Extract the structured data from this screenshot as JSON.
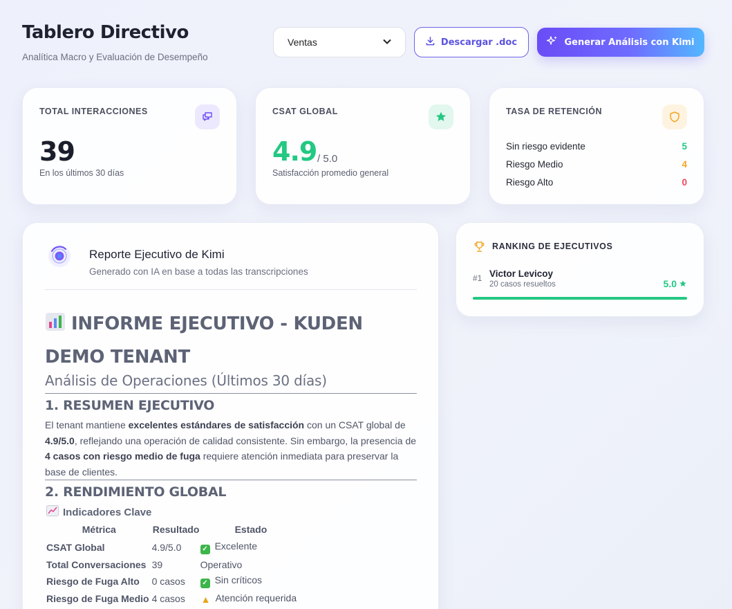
{
  "header": {
    "title": "Tablero Directivo",
    "subtitle": "Analítica Macro y Evaluación de Desempeño",
    "select_value": "Ventas",
    "download_label": "Descargar .doc",
    "ai_label": "Generar Análisis con Kimi"
  },
  "kpis": {
    "interactions": {
      "label": "TOTAL INTERACCIONES",
      "value": "39",
      "note": "En los últimos 30 días"
    },
    "csat": {
      "label": "CSAT GLOBAL",
      "value": "4.9",
      "suffix": "/ 5.0",
      "note": "Satisfacción promedio general"
    },
    "retention": {
      "label": "TASA DE RETENCIÓN",
      "rows": [
        {
          "label": "Sin riesgo evidente",
          "value": "5",
          "color": "#23c882"
        },
        {
          "label": "Riesgo Medio",
          "value": "4",
          "color": "#f5a524"
        },
        {
          "label": "Riesgo Alto",
          "value": "0",
          "color": "#ef4560"
        }
      ]
    }
  },
  "report": {
    "title": "Reporte Ejecutivo de Kimi",
    "subtitle": "Generado con IA en base a todas las transcripciones",
    "h1": "INFORME EJECUTIVO - KUDEN DEMO TENANT",
    "h2": "Análisis de Operaciones (Últimos 30 días)",
    "s1_title": "1. RESUMEN EJECUTIVO",
    "s1_p1": "El tenant mantiene ",
    "s1_b1": "excelentes estándares de satisfacción",
    "s1_p2": " con un CSAT global de ",
    "s1_b2": "4.9/5.0",
    "s1_p3": ", reflejando una operación de calidad consistente. Sin embargo, la presencia de ",
    "s1_b3": "4 casos con riesgo medio de fuga",
    "s1_p4": " requiere atención inmediata para preservar la base de clientes.",
    "s2_title": "2. RENDIMIENTO GLOBAL",
    "s2_sub": "Indicadores Clave",
    "table": {
      "headers": [
        "Métrica",
        "Resultado",
        "Estado"
      ],
      "rows": [
        {
          "metric": "CSAT Global",
          "result": "4.9/5.0",
          "state": "Excelente",
          "icon": "check"
        },
        {
          "metric": "Total Conversaciones",
          "result": "39",
          "state": "Operativo",
          "icon": "none"
        },
        {
          "metric": "Riesgo de Fuga Alto",
          "result": "0 casos",
          "state": "Sin críticos",
          "icon": "check"
        },
        {
          "metric": "Riesgo de Fuga Medio",
          "result": "4 casos",
          "state": "Atención requerida",
          "icon": "warning"
        }
      ]
    }
  },
  "ranking": {
    "title": "RANKING DE EJECUTIVOS",
    "entries": [
      {
        "position": "#1",
        "name": "Victor Levicoy",
        "cases": "20 casos resueltos",
        "score": "5.0",
        "progress": 1.0
      }
    ]
  },
  "colors": {
    "accent": "#6a4cf6",
    "success": "#23c882",
    "warning": "#f5a524",
    "danger": "#ef4560"
  }
}
